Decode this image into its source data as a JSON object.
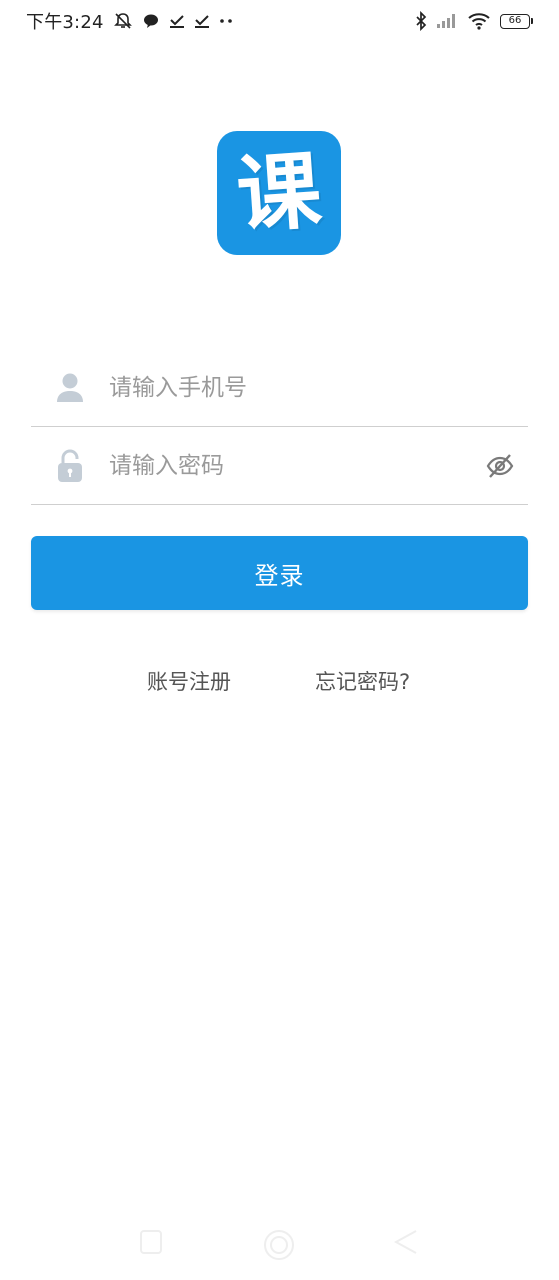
{
  "status_bar": {
    "time": "下午3:24",
    "battery_level": "66",
    "left_icons": [
      "mute-bell-icon",
      "chat-bubble-icon",
      "check-download-icon",
      "check-download-icon",
      "more-dots-icon"
    ],
    "right_icons": [
      "bluetooth-icon",
      "signal-icon",
      "wifi-icon",
      "battery-icon"
    ]
  },
  "logo": {
    "character": "课",
    "background_color": "#1a95e3"
  },
  "form": {
    "phone_placeholder": "请输入手机号",
    "phone_value": "",
    "password_placeholder": "请输入密码",
    "password_value": "",
    "login_label": "登录",
    "accent_color": "#1a95e3"
  },
  "links": {
    "register_label": "账号注册",
    "forgot_label": "忘记密码?"
  }
}
